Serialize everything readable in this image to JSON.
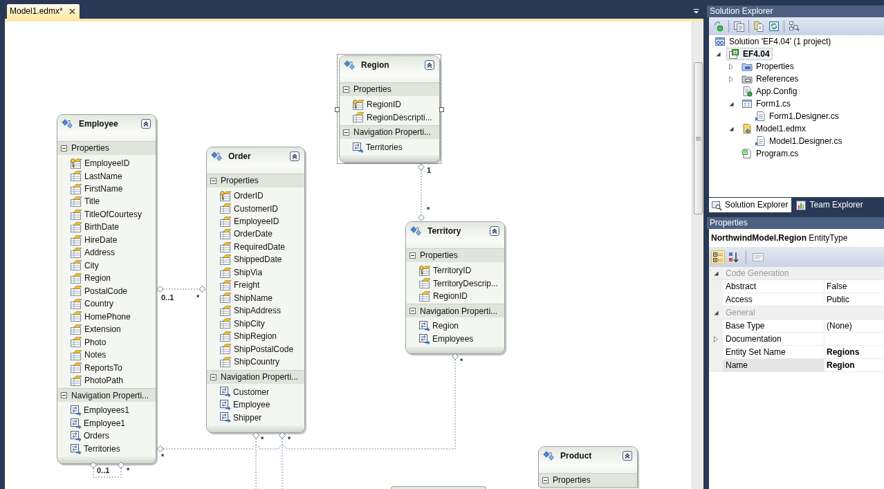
{
  "document_tabs": [
    {
      "title": "Model1.edmx*",
      "selected": true
    }
  ],
  "designer": {
    "entities": [
      {
        "name": "Region",
        "selected": true,
        "sections": [
          {
            "title": "Properties",
            "expanded": true,
            "items": [
              {
                "name": "RegionID",
                "kind": "key"
              },
              {
                "name": "RegionDescripti...",
                "kind": "scalar"
              }
            ]
          },
          {
            "title": "Navigation Properti...",
            "expanded": true,
            "items": [
              {
                "name": "Territories",
                "kind": "navigation"
              }
            ]
          }
        ]
      },
      {
        "name": "Employee",
        "selected": false,
        "sections": [
          {
            "title": "Properties",
            "expanded": true,
            "items": [
              {
                "name": "EmployeeID",
                "kind": "key"
              },
              {
                "name": "LastName",
                "kind": "scalar"
              },
              {
                "name": "FirstName",
                "kind": "scalar"
              },
              {
                "name": "Title",
                "kind": "scalar"
              },
              {
                "name": "TitleOfCourtesy",
                "kind": "scalar"
              },
              {
                "name": "BirthDate",
                "kind": "scalar"
              },
              {
                "name": "HireDate",
                "kind": "scalar"
              },
              {
                "name": "Address",
                "kind": "scalar"
              },
              {
                "name": "City",
                "kind": "scalar"
              },
              {
                "name": "Region",
                "kind": "scalar"
              },
              {
                "name": "PostalCode",
                "kind": "scalar"
              },
              {
                "name": "Country",
                "kind": "scalar"
              },
              {
                "name": "HomePhone",
                "kind": "scalar"
              },
              {
                "name": "Extension",
                "kind": "scalar"
              },
              {
                "name": "Photo",
                "kind": "scalar"
              },
              {
                "name": "Notes",
                "kind": "scalar"
              },
              {
                "name": "ReportsTo",
                "kind": "scalar"
              },
              {
                "name": "PhotoPath",
                "kind": "scalar"
              }
            ]
          },
          {
            "title": "Navigation Properti...",
            "expanded": true,
            "items": [
              {
                "name": "Employees1",
                "kind": "navigation"
              },
              {
                "name": "Employee1",
                "kind": "navigation"
              },
              {
                "name": "Orders",
                "kind": "navigation"
              },
              {
                "name": "Territories",
                "kind": "navigation"
              }
            ]
          }
        ]
      },
      {
        "name": "Order",
        "selected": false,
        "sections": [
          {
            "title": "Properties",
            "expanded": true,
            "items": [
              {
                "name": "OrderID",
                "kind": "key"
              },
              {
                "name": "CustomerID",
                "kind": "scalar"
              },
              {
                "name": "EmployeeID",
                "kind": "scalar"
              },
              {
                "name": "OrderDate",
                "kind": "scalar"
              },
              {
                "name": "RequiredDate",
                "kind": "scalar"
              },
              {
                "name": "ShippedDate",
                "kind": "scalar"
              },
              {
                "name": "ShipVia",
                "kind": "scalar"
              },
              {
                "name": "Freight",
                "kind": "scalar"
              },
              {
                "name": "ShipName",
                "kind": "scalar"
              },
              {
                "name": "ShipAddress",
                "kind": "scalar"
              },
              {
                "name": "ShipCity",
                "kind": "scalar"
              },
              {
                "name": "ShipRegion",
                "kind": "scalar"
              },
              {
                "name": "ShipPostalCode",
                "kind": "scalar"
              },
              {
                "name": "ShipCountry",
                "kind": "scalar"
              }
            ]
          },
          {
            "title": "Navigation Properti...",
            "expanded": true,
            "items": [
              {
                "name": "Customer",
                "kind": "navigation"
              },
              {
                "name": "Employee",
                "kind": "navigation"
              },
              {
                "name": "Shipper",
                "kind": "navigation"
              }
            ]
          }
        ]
      },
      {
        "name": "Territory",
        "selected": false,
        "sections": [
          {
            "title": "Properties",
            "expanded": true,
            "items": [
              {
                "name": "TerritoryID",
                "kind": "key"
              },
              {
                "name": "TerritoryDescrip...",
                "kind": "scalar"
              },
              {
                "name": "RegionID",
                "kind": "scalar"
              }
            ]
          },
          {
            "title": "Navigation Properti...",
            "expanded": true,
            "items": [
              {
                "name": "Region",
                "kind": "navigation"
              },
              {
                "name": "Employees",
                "kind": "navigation"
              }
            ]
          }
        ]
      },
      {
        "name": "Product",
        "selected": false,
        "sections": [
          {
            "title": "Properties",
            "expanded": true
          }
        ]
      },
      {
        "selected": false
      }
    ],
    "associations": [
      {
        "labels": [
          "1",
          "*"
        ]
      },
      {
        "labels": [
          "0..1",
          "*"
        ]
      },
      {
        "labels": [
          "*",
          "*"
        ]
      },
      {
        "labels": [
          "*"
        ]
      },
      {
        "labels": [
          "*"
        ]
      },
      {
        "labels": [
          "0..1",
          "*"
        ]
      }
    ]
  },
  "solution_explorer": {
    "title": "Solution Explorer",
    "tree": [
      {
        "label": "Solution 'EF4.04' (1 project)",
        "kind": "solution",
        "selected": false,
        "children": [
          {
            "label": "EF4.04",
            "kind": "project",
            "selected": true,
            "expanded": true,
            "children": [
              {
                "label": "Properties",
                "kind": "folder",
                "selected": false,
                "expanded": false
              },
              {
                "label": "References",
                "kind": "references",
                "selected": false,
                "expanded": false
              },
              {
                "label": "App.Config",
                "kind": "config",
                "selected": false
              },
              {
                "label": "Form1.cs",
                "kind": "form",
                "selected": false,
                "expanded": true,
                "children": [
                  {
                    "label": "Form1.Designer.cs",
                    "kind": "code",
                    "selected": false
                  }
                ]
              },
              {
                "label": "Model1.edmx",
                "kind": "model",
                "selected": false,
                "expanded": true,
                "children": [
                  {
                    "label": "Model1.Designer.cs",
                    "kind": "code",
                    "selected": false
                  }
                ]
              },
              {
                "label": "Program.cs",
                "kind": "csharp",
                "selected": false
              }
            ]
          }
        ]
      }
    ]
  },
  "tool_tabs": [
    {
      "label": "Solution Explorer",
      "kind": "solution",
      "selected": true
    },
    {
      "label": "Team Explorer",
      "kind": "team",
      "selected": false
    }
  ],
  "properties": {
    "title": "Properties",
    "object": "**NorthwindModel.Region** EntityType",
    "toolbar": [
      {
        "kind": "categorized",
        "selected": true,
        "disabled": false
      },
      {
        "kind": "alphabetical",
        "selected": false,
        "disabled": false
      },
      {
        "kind": "pages",
        "selected": false,
        "disabled": true
      }
    ],
    "categories": [
      {
        "title": "Code Generation",
        "expanded": true,
        "rows": [
          {
            "name": "Abstract",
            "value": "False",
            "modified": false,
            "selected": false
          },
          {
            "name": "Access",
            "value": "Public",
            "modified": false,
            "selected": false
          }
        ]
      },
      {
        "title": "General",
        "expanded": true,
        "rows": [
          {
            "name": "Base Type",
            "value": "(None)",
            "modified": false,
            "selected": false
          },
          {
            "name": "Documentation",
            "expanded": false,
            "modified": false,
            "selected": false
          },
          {
            "name": "Entity Set Name",
            "value": "Regions",
            "modified": true,
            "selected": false
          },
          {
            "name": "Name",
            "value": "Region",
            "modified": true,
            "selected": true
          }
        ]
      }
    ]
  }
}
